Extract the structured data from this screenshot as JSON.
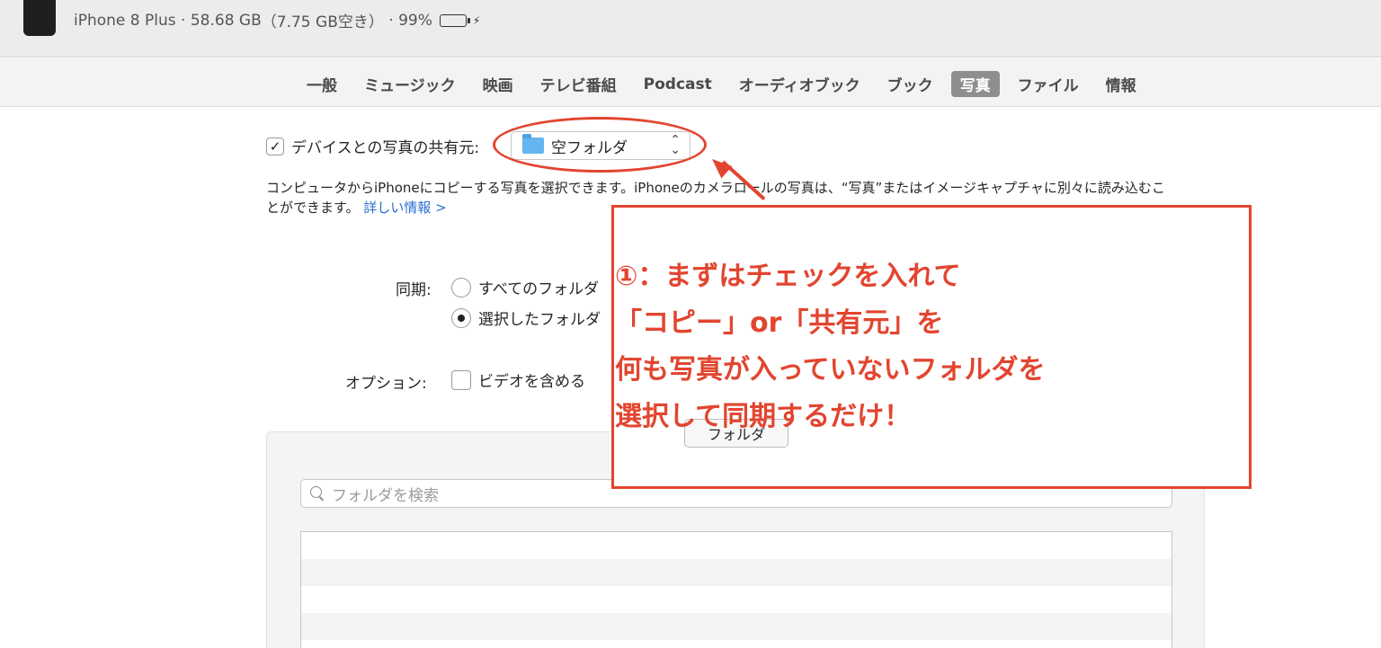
{
  "device": {
    "name": "",
    "model": "iPhone 8 Plus",
    "capacity": "58.68 GB",
    "free": "（7.75 GB空き）",
    "battery": "99%",
    "battery_level": 0.99
  },
  "tabs": [
    {
      "label": "一般",
      "active": false
    },
    {
      "label": "ミュージック",
      "active": false
    },
    {
      "label": "映画",
      "active": false
    },
    {
      "label": "テレビ番組",
      "active": false
    },
    {
      "label": "Podcast",
      "active": false
    },
    {
      "label": "オーディオブック",
      "active": false
    },
    {
      "label": "ブック",
      "active": false
    },
    {
      "label": "写真",
      "active": true
    },
    {
      "label": "ファイル",
      "active": false
    },
    {
      "label": "情報",
      "active": false
    }
  ],
  "share": {
    "checkbox_mark": "✓",
    "label": "デバイスとの写真の共有元:",
    "source_folder": "空フォルダ"
  },
  "description": {
    "text": "コンピュータからiPhoneにコピーする写真を選択できます。iPhoneのカメラロールの写真は、“写真”またはイメージキャプチャに別々に読み込むことができます。",
    "link": "詳しい情報 >"
  },
  "sync": {
    "label": "同期:",
    "option_all": "すべてのフォルダ",
    "option_selected": "選択したフォルダ",
    "selected": "option_selected"
  },
  "options": {
    "label": "オプション:",
    "include_videos": "ビデオを含める"
  },
  "folder_panel": {
    "button_label": "フォルダ",
    "search_placeholder": "フォルダを検索"
  },
  "annotation": {
    "lines": [
      "①：まずはチェックを入れて",
      "「コピー」or「共有元」を",
      "何も写真が入っていないフォルダを",
      "選択して同期するだけ！"
    ],
    "color": "#e2452f"
  },
  "colors": {
    "accent_link": "#2a6fd1",
    "active_tab": "#8e8e8e",
    "battery_green": "#2fbf2f"
  }
}
